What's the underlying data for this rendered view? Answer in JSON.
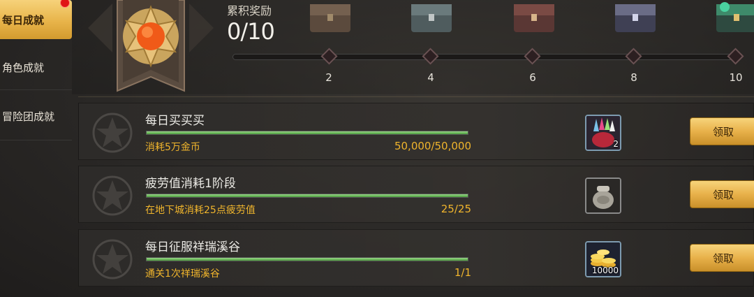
{
  "sidebar": {
    "tabs": [
      {
        "label": "每日成就",
        "active": true,
        "has_notification": true
      },
      {
        "label": "角色成就",
        "active": false
      },
      {
        "label": "冒险团成就",
        "active": false
      }
    ]
  },
  "rewards": {
    "accum_label": "累积奖励",
    "accum_value": "0/10",
    "progress": 0,
    "milestones": [
      {
        "label": "2",
        "chest": "wooden-chest-icon"
      },
      {
        "label": "4",
        "chest": "iron-chest-icon"
      },
      {
        "label": "6",
        "chest": "red-chest-icon"
      },
      {
        "label": "8",
        "chest": "silver-chest-icon"
      },
      {
        "label": "10",
        "chest": "jade-chest-icon"
      }
    ]
  },
  "tasks": [
    {
      "title": "每日买买买",
      "desc": "消耗5万金币",
      "count": "50,000/50,000",
      "progress": 1.0,
      "reward_icon": "gem-pouch-icon",
      "reward_qty": "2",
      "button": "领取"
    },
    {
      "title": "疲劳值消耗1阶段",
      "desc": "在地下城消耗25点疲劳值",
      "count": "25/25",
      "progress": 1.0,
      "reward_icon": "clay-jar-icon",
      "reward_qty": "",
      "button": "领取"
    },
    {
      "title": "每日征服祥瑞溪谷",
      "desc": "通关1次祥瑞溪谷",
      "count": "1/1",
      "progress": 1.0,
      "reward_icon": "gold-coins-icon",
      "reward_qty": "10000",
      "button": "领取"
    }
  ],
  "colors": {
    "accent_gold": "#e8b14a",
    "progress_green": "#4a9a3a",
    "desc_orange": "#f0b52c",
    "notification_red": "#e01515"
  }
}
